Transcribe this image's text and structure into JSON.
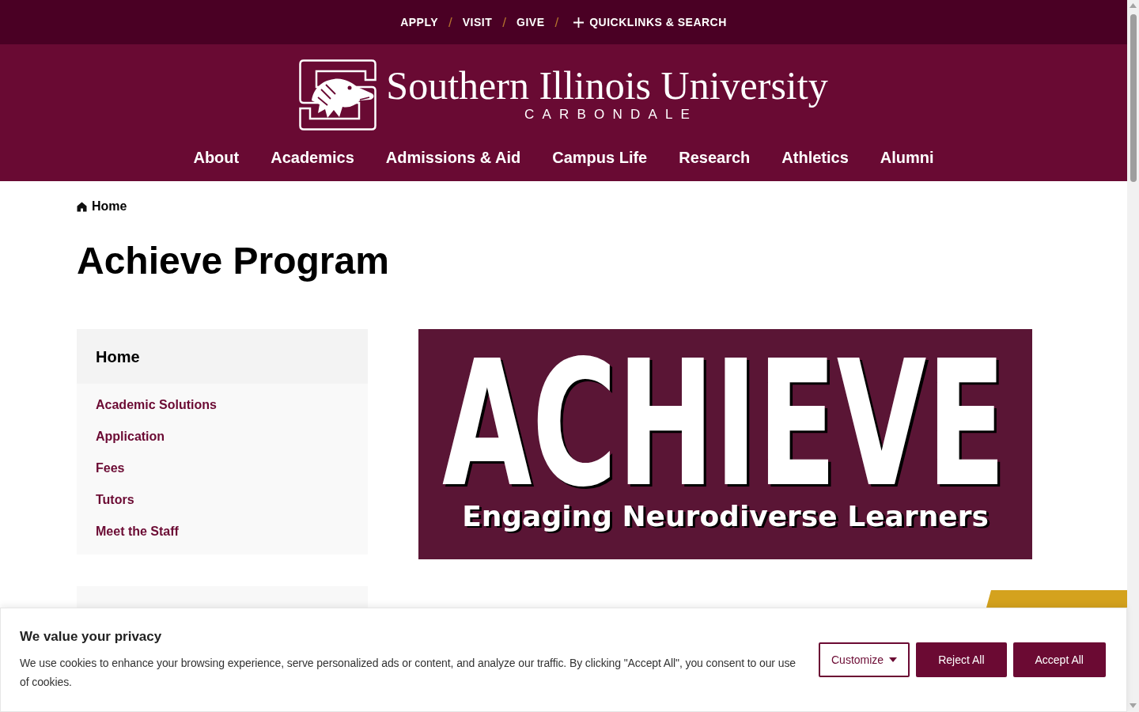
{
  "top_bar": {
    "items": [
      {
        "kind": "link",
        "label": "APPLY"
      },
      {
        "kind": "separator",
        "label": "/"
      },
      {
        "kind": "link",
        "label": "VISIT"
      },
      {
        "kind": "separator",
        "label": "/"
      },
      {
        "kind": "link",
        "label": "GIVE"
      },
      {
        "kind": "separator",
        "label": "/"
      },
      {
        "kind": "toggle",
        "label": "QUICKLINKS & SEARCH"
      }
    ]
  },
  "header": {
    "logo_name": "Southern Illinois University",
    "logo_campus": "CARBONDALE",
    "nav": [
      "About",
      "Academics",
      "Admissions & Aid",
      "Campus Life",
      "Research",
      "Athletics",
      "Alumni"
    ]
  },
  "breadcrumb": [
    "Home"
  ],
  "page_title": "Achieve Program",
  "sidebar": {
    "heading": "Home",
    "items": [
      "Academic Solutions",
      "Application",
      "Fees",
      "Tutors",
      "Meet the Staff"
    ]
  },
  "banner": {
    "title": "ACHIEVE",
    "subtitle": "Engaging Neurodiverse Learners"
  },
  "cookie_banner": {
    "title": "We value your privacy",
    "text": "We use cookies to enhance your browsing experience, serve personalized ads or content, and analyze our traffic. By clicking \"Accept All\", you consent to our use of cookies.",
    "buttons": [
      {
        "kind": "dropdown",
        "label": "Customize"
      },
      {
        "kind": "primary",
        "label": "Reject All"
      },
      {
        "kind": "primary",
        "label": "Accept All"
      }
    ]
  }
}
